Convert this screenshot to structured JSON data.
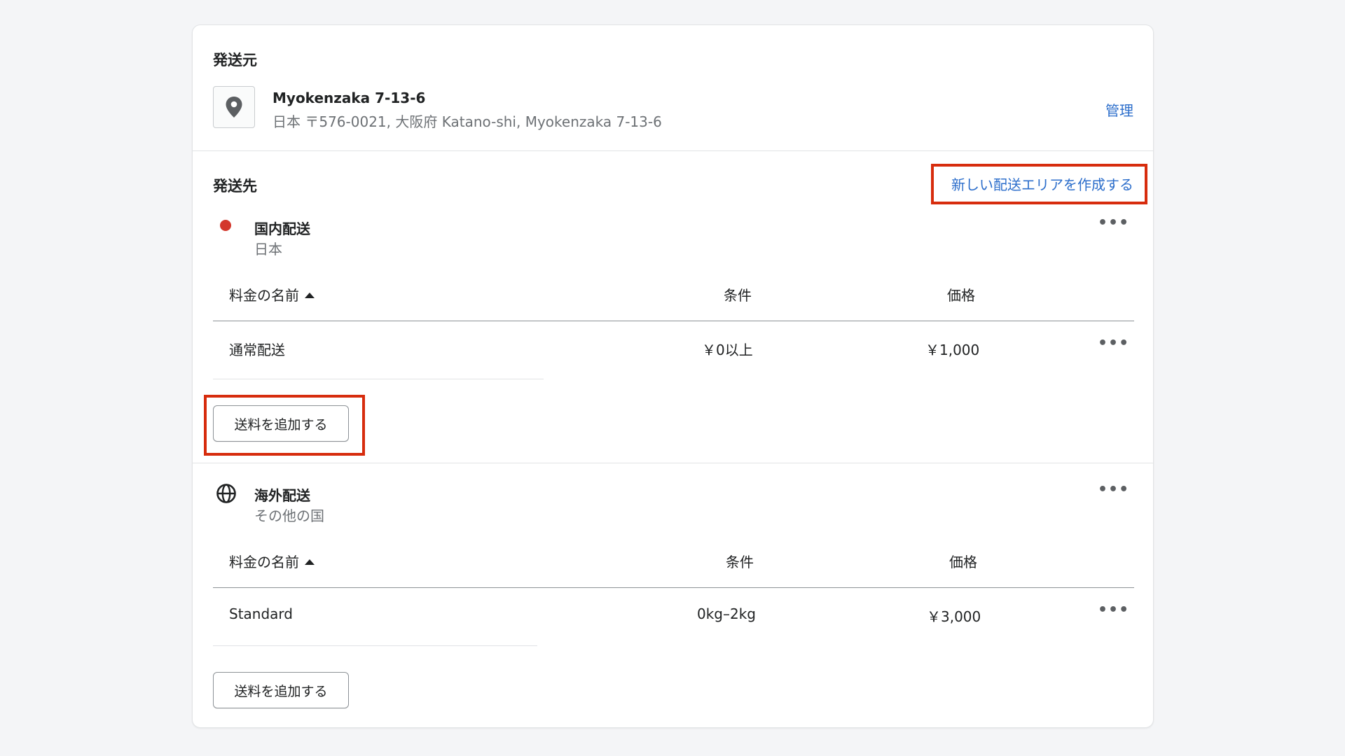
{
  "origin": {
    "heading": "発送元",
    "location_name": "Myokenzaka 7-13-6",
    "location_address": "日本 〒576-0021, 大阪府 Katano-shi, Myokenzaka 7-13-6",
    "manage_link": "管理",
    "icon": "map-pin-icon"
  },
  "destination": {
    "heading": "発送先",
    "create_zone_link": "新しい配送エリアを作成する"
  },
  "zones": [
    {
      "name": "国内配送",
      "subtitle": "日本",
      "icon": "red-dot",
      "columns": {
        "name": "料金の名前",
        "condition": "条件",
        "price": "価格"
      },
      "rates": [
        {
          "name": "通常配送",
          "condition": "￥0以上",
          "price": "￥1,000"
        }
      ],
      "add_rate_button": "送料を追加する"
    },
    {
      "name": "海外配送",
      "subtitle": "その他の国",
      "icon": "globe-icon",
      "columns": {
        "name": "料金の名前",
        "condition": "条件",
        "price": "価格"
      },
      "rates": [
        {
          "name": "Standard",
          "condition": "0kg–2kg",
          "price": "￥3,000"
        }
      ],
      "add_rate_button": "送料を追加する"
    }
  ],
  "colors": {
    "link": "#2c6ecb",
    "highlight": "#d72c0d",
    "domestic_dot": "#d3382c"
  }
}
